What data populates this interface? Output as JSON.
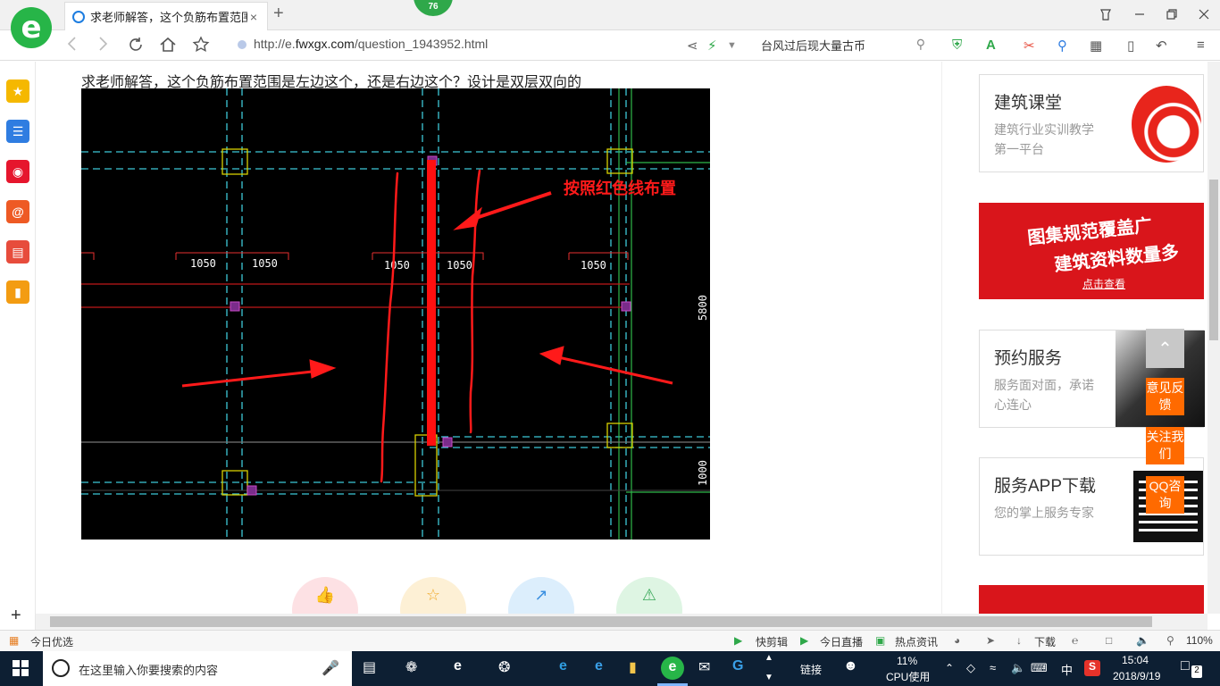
{
  "browser": {
    "tab_title": "求老师解答，这个负筋布置范围是",
    "tab_close": "×",
    "new_tab": "+",
    "badge_count": "76",
    "url_prefix": "http://e.",
    "url_domain": "fwxgx.com",
    "url_path": "/question_1943952.html",
    "search_text": "台风过后现大量古币",
    "search_icon": "search-icon",
    "nav_icons": [
      "back-icon",
      "forward-icon",
      "refresh-icon",
      "home-icon",
      "star-icon"
    ],
    "window_controls": [
      "restore-icon",
      "minimize-icon",
      "maximize-icon",
      "close-icon"
    ]
  },
  "left_sidebar": {
    "items": [
      {
        "icon": "favorites-icon",
        "color": "#f5b800"
      },
      {
        "icon": "news-icon",
        "color": "#2f7de1"
      },
      {
        "icon": "weibo-icon",
        "color": "#e6162d"
      },
      {
        "icon": "mail-icon",
        "color": "#ee5a24"
      },
      {
        "icon": "game-icon",
        "color": "#e74c3c"
      },
      {
        "icon": "notes-icon",
        "color": "#f39c12"
      }
    ],
    "add_label": "+"
  },
  "content": {
    "question": "求老师解答，这个负筋布置范围是左边这个，还是右边这个？设计是双层双向的",
    "cad": {
      "annotation": "按照红色线布置",
      "dims": [
        "1050",
        "1050",
        "1050",
        "1050",
        "1050"
      ],
      "side_dims": [
        "5800",
        "1000"
      ]
    },
    "actions": [
      {
        "icon": "thumbs-up-icon",
        "color": "#fde1e4"
      },
      {
        "icon": "favorite-star-icon",
        "color": "#fdf0d5"
      },
      {
        "icon": "share-icon",
        "color": "#dceefc"
      },
      {
        "icon": "report-icon",
        "color": "#def5e3"
      }
    ]
  },
  "right_panel": {
    "cards": [
      {
        "title": "建筑课堂",
        "desc": "建筑行业实训教学第一平台"
      },
      {
        "title": "预约服务",
        "desc": "服务面对面，承诺心连心"
      },
      {
        "title": "服务APP下载",
        "desc": "您的掌上服务专家"
      }
    ],
    "ad": {
      "line1": "图集规范覆盖广",
      "line2": "建筑资料数量多",
      "cta": "点击查看"
    },
    "float_buttons": [
      "意见反馈",
      "关注我们",
      "QQ咨询"
    ]
  },
  "status_bar": {
    "left": "今日优选",
    "items": [
      "快剪辑",
      "今日直播",
      "热点资讯",
      "下载"
    ],
    "zoom": "110%"
  },
  "taskbar": {
    "search_placeholder": "在这里输入你要搜索的内容",
    "link_label": "链接",
    "cpu_percent": "11%",
    "cpu_label": "CPU使用",
    "ime": "中",
    "time": "15:04",
    "date": "2018/9/19",
    "notifications": "2"
  }
}
